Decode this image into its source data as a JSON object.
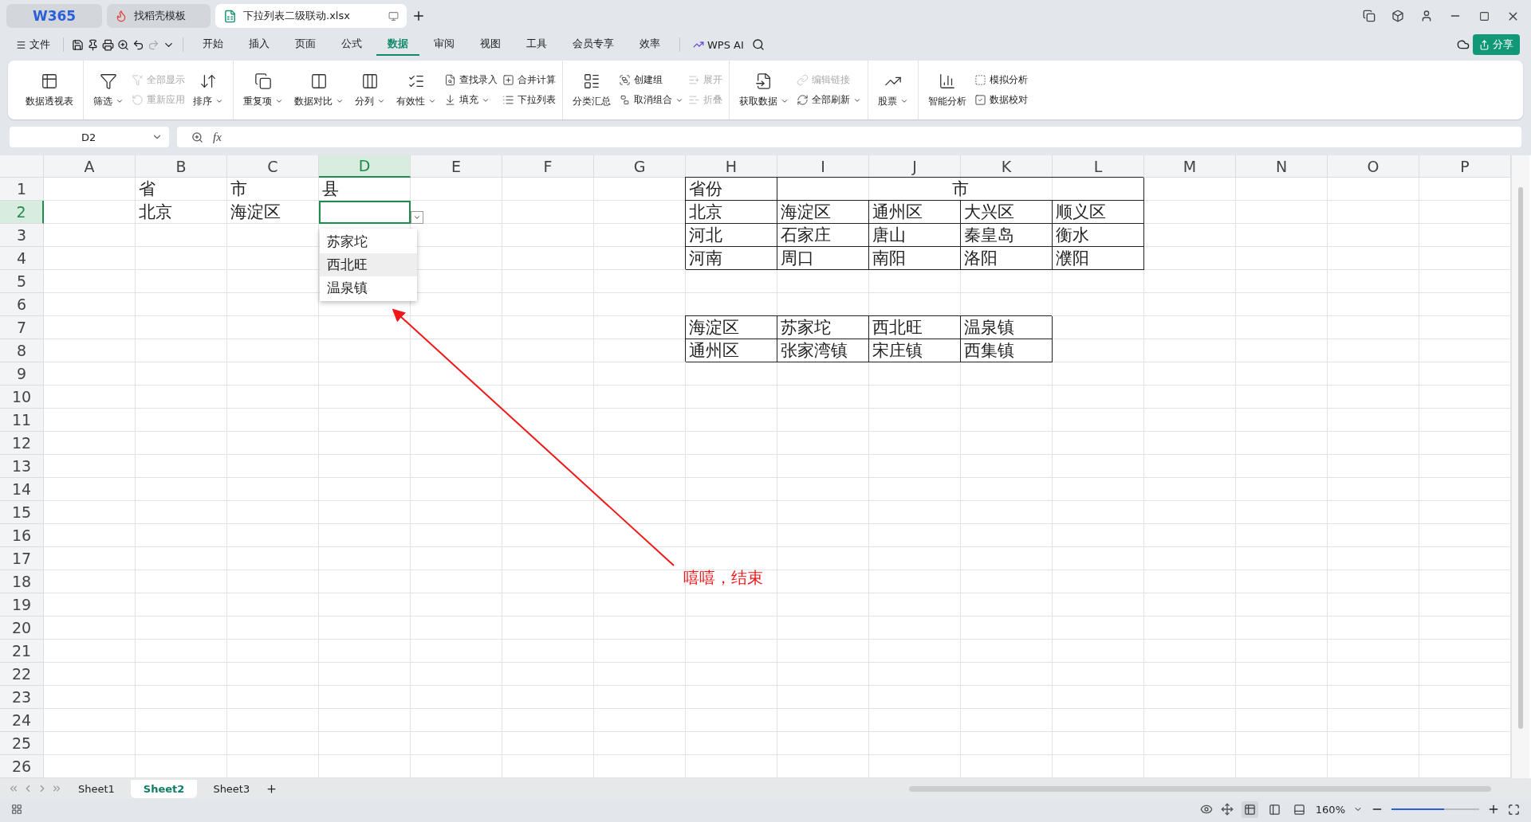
{
  "title_tabs": [
    {
      "kind": "brand",
      "label": "W365",
      "selected": false
    },
    {
      "kind": "template",
      "label": "找稻壳模板",
      "selected": false
    },
    {
      "kind": "sheet",
      "label": "下拉列表二级联动.xlsx",
      "selected": true
    }
  ],
  "menu": {
    "file": "文件",
    "tabs": [
      {
        "label": "开始",
        "selected": false
      },
      {
        "label": "插入",
        "selected": false
      },
      {
        "label": "页面",
        "selected": false
      },
      {
        "label": "公式",
        "selected": false
      },
      {
        "label": "数据",
        "selected": true
      },
      {
        "label": "审阅",
        "selected": false
      },
      {
        "label": "视图",
        "selected": false
      },
      {
        "label": "工具",
        "selected": false
      },
      {
        "label": "会员专享",
        "selected": false
      },
      {
        "label": "效率",
        "selected": false
      }
    ],
    "ai": "WPS AI",
    "share": "分享"
  },
  "ribbon": [
    {
      "items": [
        {
          "kind": "large",
          "label": "数据透视表",
          "caret": false,
          "disabled": false
        }
      ]
    },
    {
      "items": [
        {
          "kind": "large",
          "label": "筛选",
          "caret": true,
          "disabled": false
        },
        {
          "kind": "stack",
          "entries": [
            {
              "label": "全部显示",
              "caret": false,
              "disabled": true
            },
            {
              "label": "重新应用",
              "caret": false,
              "disabled": true
            }
          ]
        },
        {
          "kind": "large",
          "label": "排序",
          "caret": true,
          "disabled": false
        }
      ]
    },
    {
      "items": [
        {
          "kind": "large",
          "label": "重复项",
          "caret": true,
          "disabled": false
        },
        {
          "kind": "large",
          "label": "数据对比",
          "caret": true,
          "disabled": false
        },
        {
          "kind": "large",
          "label": "分列",
          "caret": true,
          "disabled": false
        },
        {
          "kind": "large",
          "label": "有效性",
          "caret": true,
          "disabled": false
        },
        {
          "kind": "stack",
          "entries": [
            {
              "label": "查找录入",
              "caret": false,
              "disabled": false
            },
            {
              "label": "填充",
              "caret": true,
              "disabled": false
            }
          ]
        },
        {
          "kind": "stack",
          "entries": [
            {
              "label": "合并计算",
              "caret": false,
              "disabled": false
            },
            {
              "label": "下拉列表",
              "caret": false,
              "disabled": false
            }
          ]
        }
      ]
    },
    {
      "items": [
        {
          "kind": "large",
          "label": "分类汇总",
          "caret": false,
          "disabled": false
        },
        {
          "kind": "stack",
          "entries": [
            {
              "label": "创建组",
              "caret": false,
              "disabled": false
            },
            {
              "label": "取消组合",
              "caret": true,
              "disabled": false
            }
          ]
        },
        {
          "kind": "stack",
          "entries": [
            {
              "label": "展开",
              "caret": false,
              "disabled": true
            },
            {
              "label": "折叠",
              "caret": false,
              "disabled": true
            }
          ]
        }
      ]
    },
    {
      "items": [
        {
          "kind": "large",
          "label": "获取数据",
          "caret": true,
          "disabled": false
        },
        {
          "kind": "stack",
          "entries": [
            {
              "label": "编辑链接",
              "caret": false,
              "disabled": true
            },
            {
              "label": "全部刷新",
              "caret": true,
              "disabled": false
            }
          ]
        }
      ]
    },
    {
      "items": [
        {
          "kind": "large",
          "label": "股票",
          "caret": true,
          "disabled": false
        }
      ]
    },
    {
      "items": [
        {
          "kind": "large",
          "label": "智能分析",
          "caret": false,
          "disabled": false
        },
        {
          "kind": "stack",
          "entries": [
            {
              "label": "模拟分析",
              "caret": false,
              "disabled": false
            },
            {
              "label": "数据校对",
              "caret": false,
              "disabled": false
            }
          ]
        }
      ]
    }
  ],
  "formula_bar": {
    "name_box": "D2",
    "fx": "fx"
  },
  "sheet": {
    "columns": [
      {
        "label": "A",
        "selected": false
      },
      {
        "label": "B",
        "selected": false
      },
      {
        "label": "C",
        "selected": false
      },
      {
        "label": "D",
        "selected": true
      },
      {
        "label": "E",
        "selected": false
      },
      {
        "label": "F",
        "selected": false
      },
      {
        "label": "G",
        "selected": false
      },
      {
        "label": "H",
        "selected": false
      },
      {
        "label": "I",
        "selected": false
      },
      {
        "label": "J",
        "selected": false
      },
      {
        "label": "K",
        "selected": false
      },
      {
        "label": "L",
        "selected": false
      },
      {
        "label": "M",
        "selected": false
      },
      {
        "label": "N",
        "selected": false
      },
      {
        "label": "O",
        "selected": false
      },
      {
        "label": "P",
        "selected": false
      }
    ],
    "rows": [
      {
        "number": "1",
        "selected": false,
        "cells": [
          {
            "kind": "empty"
          },
          {
            "kind": "text",
            "text": "省"
          },
          {
            "kind": "text",
            "text": "市"
          },
          {
            "kind": "text",
            "text": "县"
          },
          {
            "kind": "empty"
          },
          {
            "kind": "empty"
          },
          {
            "kind": "empty"
          },
          {
            "kind": "boxed",
            "text": "省份"
          },
          {
            "kind": "merged",
            "text": "市"
          }
        ]
      },
      {
        "number": "2",
        "selected": true,
        "cells": [
          {
            "kind": "empty"
          },
          {
            "kind": "text",
            "text": "北京"
          },
          {
            "kind": "text",
            "text": "海淀区"
          },
          {
            "kind": "active"
          },
          {
            "kind": "empty"
          },
          {
            "kind": "empty"
          },
          {
            "kind": "empty"
          },
          {
            "kind": "boxed",
            "text": "北京"
          },
          {
            "kind": "boxed",
            "text": "海淀区"
          },
          {
            "kind": "boxed",
            "text": "通州区"
          },
          {
            "kind": "boxed",
            "text": "大兴区"
          },
          {
            "kind": "boxed",
            "text": "顺义区"
          }
        ]
      },
      {
        "number": "3",
        "selected": false,
        "cells": [
          {
            "kind": "empty"
          },
          {
            "kind": "empty"
          },
          {
            "kind": "empty"
          },
          {
            "kind": "empty"
          },
          {
            "kind": "empty"
          },
          {
            "kind": "empty"
          },
          {
            "kind": "empty"
          },
          {
            "kind": "boxed",
            "text": "河北"
          },
          {
            "kind": "boxed",
            "text": "石家庄"
          },
          {
            "kind": "boxed",
            "text": "唐山"
          },
          {
            "kind": "boxed",
            "text": "秦皇岛"
          },
          {
            "kind": "boxed",
            "text": "衡水"
          }
        ]
      },
      {
        "number": "4",
        "selected": false,
        "cells": [
          {
            "kind": "empty"
          },
          {
            "kind": "empty"
          },
          {
            "kind": "empty"
          },
          {
            "kind": "empty"
          },
          {
            "kind": "empty"
          },
          {
            "kind": "empty"
          },
          {
            "kind": "empty"
          },
          {
            "kind": "boxed",
            "text": "河南"
          },
          {
            "kind": "boxed",
            "text": "周口"
          },
          {
            "kind": "boxed",
            "text": "南阳"
          },
          {
            "kind": "boxed",
            "text": "洛阳"
          },
          {
            "kind": "boxed",
            "text": "濮阳"
          }
        ]
      },
      {
        "number": "5",
        "selected": false
      },
      {
        "number": "6",
        "selected": false
      },
      {
        "number": "7",
        "selected": false,
        "cells": [
          {
            "kind": "empty"
          },
          {
            "kind": "empty"
          },
          {
            "kind": "empty"
          },
          {
            "kind": "empty"
          },
          {
            "kind": "empty"
          },
          {
            "kind": "empty"
          },
          {
            "kind": "empty"
          },
          {
            "kind": "boxed",
            "text": "海淀区"
          },
          {
            "kind": "boxed",
            "text": "苏家坨"
          },
          {
            "kind": "boxed",
            "text": "西北旺"
          },
          {
            "kind": "boxed",
            "text": "温泉镇"
          }
        ]
      },
      {
        "number": "8",
        "selected": false,
        "cells": [
          {
            "kind": "empty"
          },
          {
            "kind": "empty"
          },
          {
            "kind": "empty"
          },
          {
            "kind": "empty"
          },
          {
            "kind": "empty"
          },
          {
            "kind": "empty"
          },
          {
            "kind": "empty"
          },
          {
            "kind": "boxed",
            "text": "通州区"
          },
          {
            "kind": "boxed",
            "text": "张家湾镇"
          },
          {
            "kind": "boxed",
            "text": "宋庄镇"
          },
          {
            "kind": "boxed",
            "text": "西集镇"
          }
        ]
      },
      {
        "number": "9",
        "selected": false
      },
      {
        "number": "10",
        "selected": false
      },
      {
        "number": "11",
        "selected": false
      },
      {
        "number": "12",
        "selected": false
      },
      {
        "number": "13",
        "selected": false
      },
      {
        "number": "14",
        "selected": false
      },
      {
        "number": "15",
        "selected": false
      },
      {
        "number": "16",
        "selected": false
      },
      {
        "number": "17",
        "selected": false
      },
      {
        "number": "18",
        "selected": false
      },
      {
        "number": "19",
        "selected": false
      },
      {
        "number": "20",
        "selected": false
      },
      {
        "number": "21",
        "selected": false
      },
      {
        "number": "22",
        "selected": false
      },
      {
        "number": "23",
        "selected": false
      },
      {
        "number": "24",
        "selected": false
      },
      {
        "number": "25",
        "selected": false
      },
      {
        "number": "26",
        "selected": false
      }
    ]
  },
  "dropdown": [
    {
      "label": "苏家坨",
      "selected": false
    },
    {
      "label": "西北旺",
      "selected": true
    },
    {
      "label": "温泉镇",
      "selected": false
    }
  ],
  "annotation": {
    "text": "嘻嘻，结束"
  },
  "sheet_tabs": [
    {
      "label": "Sheet1",
      "selected": false
    },
    {
      "label": "Sheet2",
      "selected": true
    },
    {
      "label": "Sheet3",
      "selected": false
    }
  ],
  "status_bar": {
    "view_modes": [
      {
        "selected": true
      },
      {
        "selected": false
      },
      {
        "selected": false
      }
    ],
    "zoom": "160%",
    "zoom_slider": {
      "level": 0.6
    }
  }
}
